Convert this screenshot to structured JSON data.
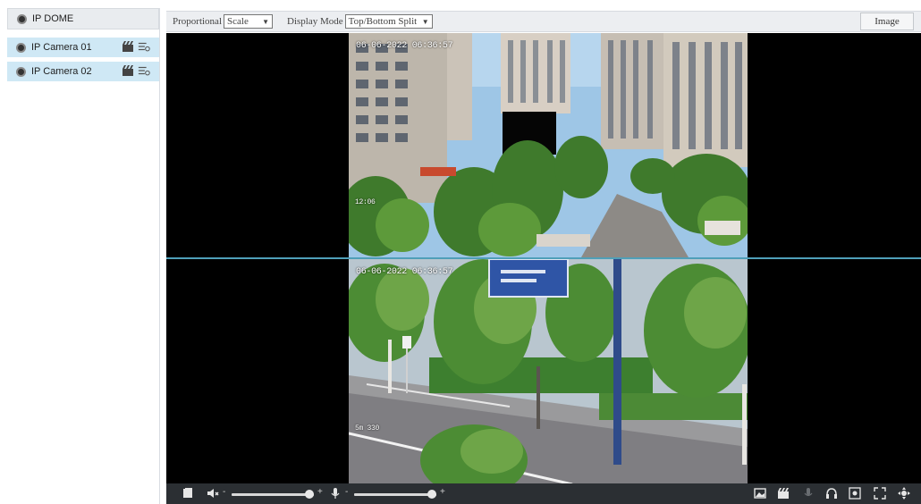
{
  "sidebar": {
    "root_label": "IP DOME",
    "cameras": [
      {
        "label": "IP Camera 01"
      },
      {
        "label": "IP Camera 02"
      }
    ]
  },
  "toolbar": {
    "proportional_label": "Proportional",
    "proportional_value": "Scale",
    "display_mode_label": "Display Mode",
    "display_mode_value": "Top/Bottom Split",
    "image_button": "Image"
  },
  "video": {
    "top_timestamp": "06-06-2022 06:36:57",
    "top_small_tag": "12:06",
    "bottom_timestamp": "06-06-2022 06:36:57",
    "bottom_small_tag": "5m 330"
  },
  "controls": {
    "volume_minus": "-",
    "volume_plus": "+",
    "mic_minus": "-",
    "mic_plus": "+",
    "volume_level": 0.95,
    "mic_level": 0.95
  },
  "icons": {
    "stop_all": "stop-icon",
    "volume": "speaker-icon",
    "microphone": "microphone-icon",
    "snapshot": "snapshot-icon",
    "record": "record-icon",
    "talk": "talk-icon",
    "audio": "headset-icon",
    "zoom": "zoom-icon",
    "fullscreen": "fullscreen-icon",
    "ptz": "ptz-icon"
  },
  "colors": {
    "selected_row": "#cfe8f5",
    "split_line": "#4f9fb8",
    "control_bar": "#2b2f33"
  }
}
